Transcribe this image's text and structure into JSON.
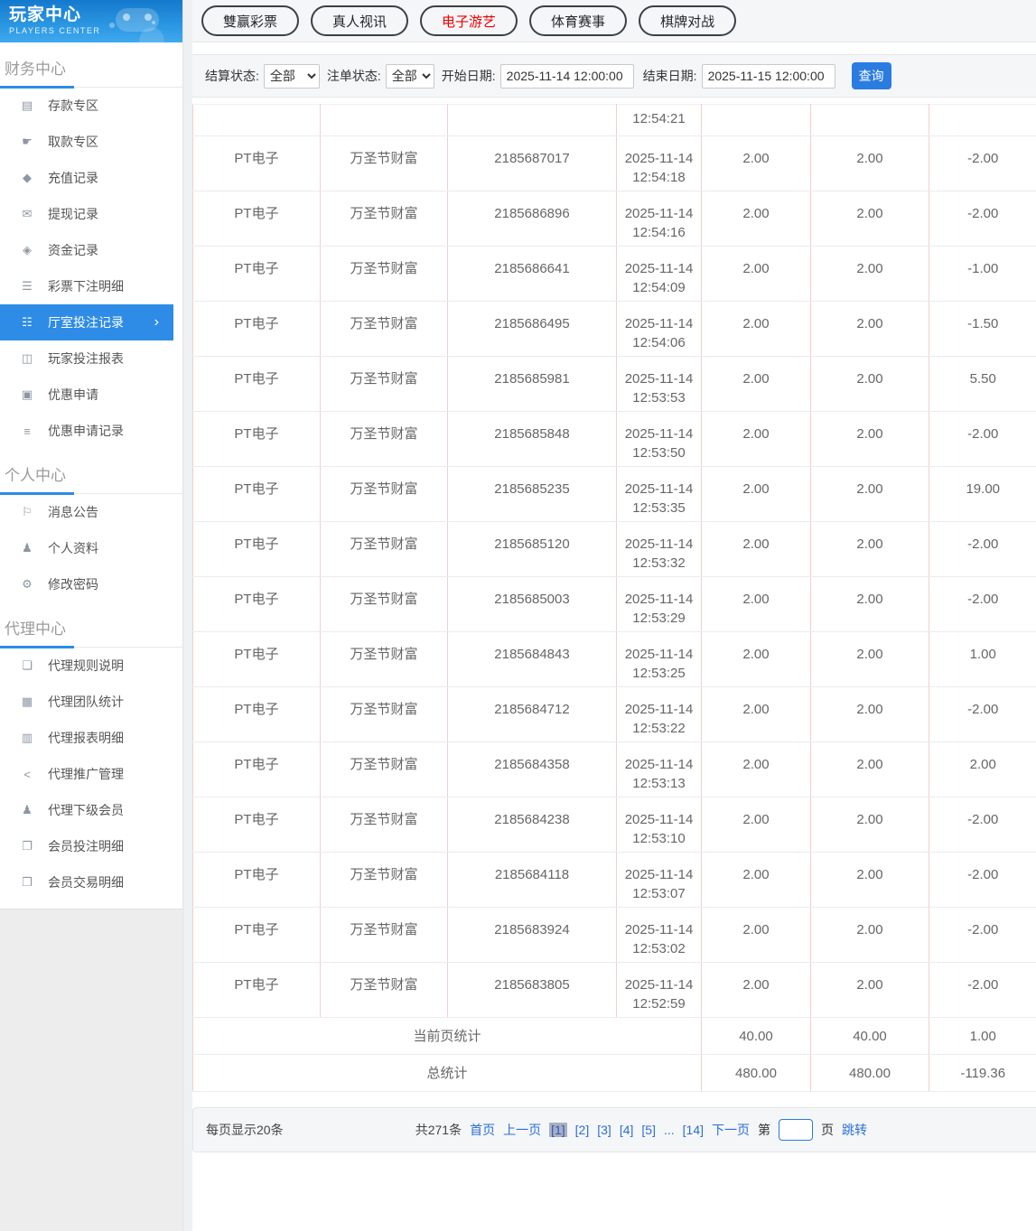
{
  "sidebar": {
    "title": "玩家中心",
    "subtitle": "PLAYERS CENTER",
    "sections": [
      {
        "label": "财务中心",
        "items": [
          {
            "icon_name": "deposit-card-icon",
            "glyph": "▤",
            "label": "存款专区",
            "active": false
          },
          {
            "icon_name": "withdraw-hand-icon",
            "glyph": "☛",
            "label": "取款专区",
            "active": false
          },
          {
            "icon_name": "recharge-record-icon",
            "glyph": "◆",
            "label": "充值记录",
            "active": false
          },
          {
            "icon_name": "withdraw-record-icon",
            "glyph": "✉",
            "label": "提现记录",
            "active": false
          },
          {
            "icon_name": "funds-record-icon",
            "glyph": "◈",
            "label": "资金记录",
            "active": false
          },
          {
            "icon_name": "lottery-bet-detail-icon",
            "glyph": "☰",
            "label": "彩票下注明细",
            "active": false
          },
          {
            "icon_name": "hall-bet-record-icon",
            "glyph": "☷",
            "label": "厅室投注记录",
            "active": true
          },
          {
            "icon_name": "player-bet-report-icon",
            "glyph": "◫",
            "label": "玩家投注报表",
            "active": false
          },
          {
            "icon_name": "promo-apply-icon",
            "glyph": "▣",
            "label": "优惠申请",
            "active": false
          },
          {
            "icon_name": "promo-apply-record-icon",
            "glyph": "≡",
            "label": "优惠申请记录",
            "active": false
          }
        ]
      },
      {
        "label": "个人中心",
        "items": [
          {
            "icon_name": "bell-icon",
            "glyph": "⚐",
            "label": "消息公告",
            "active": false
          },
          {
            "icon_name": "user-icon",
            "glyph": "♟",
            "label": "个人资料",
            "active": false
          },
          {
            "icon_name": "gear-icon",
            "glyph": "⚙",
            "label": "修改密码",
            "active": false
          }
        ]
      },
      {
        "label": "代理中心",
        "items": [
          {
            "icon_name": "document-icon",
            "glyph": "❏",
            "label": "代理规则说明",
            "active": false
          },
          {
            "icon_name": "team-stats-icon",
            "glyph": "▦",
            "label": "代理团队统计",
            "active": false
          },
          {
            "icon_name": "report-detail-icon",
            "glyph": "▥",
            "label": "代理报表明细",
            "active": false
          },
          {
            "icon_name": "share-icon",
            "glyph": "<",
            "label": "代理推广管理",
            "active": false
          },
          {
            "icon_name": "members-icon",
            "glyph": "♟",
            "label": "代理下级会员",
            "active": false
          },
          {
            "icon_name": "member-bet-icon",
            "glyph": "❐",
            "label": "会员投注明细",
            "active": false
          },
          {
            "icon_name": "member-trade-icon",
            "glyph": "❒",
            "label": "会员交易明细",
            "active": false
          }
        ]
      }
    ]
  },
  "tabs": [
    {
      "label": "雙赢彩票",
      "active": false
    },
    {
      "label": "真人视讯",
      "active": false
    },
    {
      "label": "电子游艺",
      "active": true
    },
    {
      "label": "体育赛事",
      "active": false
    },
    {
      "label": "棋牌对战",
      "active": false
    }
  ],
  "filters": {
    "settle_status_label": "结算状态:",
    "settle_status_value": "全部",
    "order_status_label": "注单状态:",
    "order_status_value": "全部",
    "start_date_label": "开始日期:",
    "start_date_value": "2025-11-14 12:00:00",
    "end_date_label": "结束日期:",
    "end_date_value": "2025-11-15 12:00:00",
    "query_label": "查询"
  },
  "table": {
    "partial_row_time": "12:54:21",
    "rows": [
      {
        "hall": "PT电子",
        "game": "万圣节财富",
        "order": "2185687017",
        "date": "2025-11-14",
        "time": "12:54:18",
        "bet": "2.00",
        "valid": "2.00",
        "result": "-2.00"
      },
      {
        "hall": "PT电子",
        "game": "万圣节财富",
        "order": "2185686896",
        "date": "2025-11-14",
        "time": "12:54:16",
        "bet": "2.00",
        "valid": "2.00",
        "result": "-2.00"
      },
      {
        "hall": "PT电子",
        "game": "万圣节财富",
        "order": "2185686641",
        "date": "2025-11-14",
        "time": "12:54:09",
        "bet": "2.00",
        "valid": "2.00",
        "result": "-1.00"
      },
      {
        "hall": "PT电子",
        "game": "万圣节财富",
        "order": "2185686495",
        "date": "2025-11-14",
        "time": "12:54:06",
        "bet": "2.00",
        "valid": "2.00",
        "result": "-1.50"
      },
      {
        "hall": "PT电子",
        "game": "万圣节财富",
        "order": "2185685981",
        "date": "2025-11-14",
        "time": "12:53:53",
        "bet": "2.00",
        "valid": "2.00",
        "result": "5.50"
      },
      {
        "hall": "PT电子",
        "game": "万圣节财富",
        "order": "2185685848",
        "date": "2025-11-14",
        "time": "12:53:50",
        "bet": "2.00",
        "valid": "2.00",
        "result": "-2.00"
      },
      {
        "hall": "PT电子",
        "game": "万圣节财富",
        "order": "2185685235",
        "date": "2025-11-14",
        "time": "12:53:35",
        "bet": "2.00",
        "valid": "2.00",
        "result": "19.00"
      },
      {
        "hall": "PT电子",
        "game": "万圣节财富",
        "order": "2185685120",
        "date": "2025-11-14",
        "time": "12:53:32",
        "bet": "2.00",
        "valid": "2.00",
        "result": "-2.00"
      },
      {
        "hall": "PT电子",
        "game": "万圣节财富",
        "order": "2185685003",
        "date": "2025-11-14",
        "time": "12:53:29",
        "bet": "2.00",
        "valid": "2.00",
        "result": "-2.00"
      },
      {
        "hall": "PT电子",
        "game": "万圣节财富",
        "order": "2185684843",
        "date": "2025-11-14",
        "time": "12:53:25",
        "bet": "2.00",
        "valid": "2.00",
        "result": "1.00"
      },
      {
        "hall": "PT电子",
        "game": "万圣节财富",
        "order": "2185684712",
        "date": "2025-11-14",
        "time": "12:53:22",
        "bet": "2.00",
        "valid": "2.00",
        "result": "-2.00"
      },
      {
        "hall": "PT电子",
        "game": "万圣节财富",
        "order": "2185684358",
        "date": "2025-11-14",
        "time": "12:53:13",
        "bet": "2.00",
        "valid": "2.00",
        "result": "2.00"
      },
      {
        "hall": "PT电子",
        "game": "万圣节财富",
        "order": "2185684238",
        "date": "2025-11-14",
        "time": "12:53:10",
        "bet": "2.00",
        "valid": "2.00",
        "result": "-2.00"
      },
      {
        "hall": "PT电子",
        "game": "万圣节财富",
        "order": "2185684118",
        "date": "2025-11-14",
        "time": "12:53:07",
        "bet": "2.00",
        "valid": "2.00",
        "result": "-2.00"
      },
      {
        "hall": "PT电子",
        "game": "万圣节财富",
        "order": "2185683924",
        "date": "2025-11-14",
        "time": "12:53:02",
        "bet": "2.00",
        "valid": "2.00",
        "result": "-2.00"
      },
      {
        "hall": "PT电子",
        "game": "万圣节财富",
        "order": "2185683805",
        "date": "2025-11-14",
        "time": "12:52:59",
        "bet": "2.00",
        "valid": "2.00",
        "result": "-2.00"
      }
    ],
    "page_stats": {
      "label": "当前页统计",
      "bet": "40.00",
      "valid": "40.00",
      "result": "1.00"
    },
    "total_stats": {
      "label": "总统计",
      "bet": "480.00",
      "valid": "480.00",
      "result": "-119.36"
    }
  },
  "pagination": {
    "per_page": "每页显示20条",
    "total": "共271条",
    "first": "首页",
    "prev": "上一页",
    "pages": [
      "[1]",
      "[2]",
      "[3]",
      "[4]",
      "[5]"
    ],
    "current_index": 0,
    "ellipsis": "...",
    "last_page": "[14]",
    "next": "下一页",
    "jump_prefix": "第",
    "jump_suffix": "页",
    "jump_label": "跳转",
    "jump_value": ""
  },
  "colors": {
    "accent_blue": "#2e8ce6",
    "button_blue": "#2b7ce0",
    "active_tab_red": "#ee0000",
    "link_blue": "#2a6fd6",
    "table_border_pink": "#f2cfcf",
    "current_page_bg": "#a9b0bd",
    "header_gradient_top": "#1479cd",
    "header_gradient_bottom": "#3fa9ee"
  }
}
